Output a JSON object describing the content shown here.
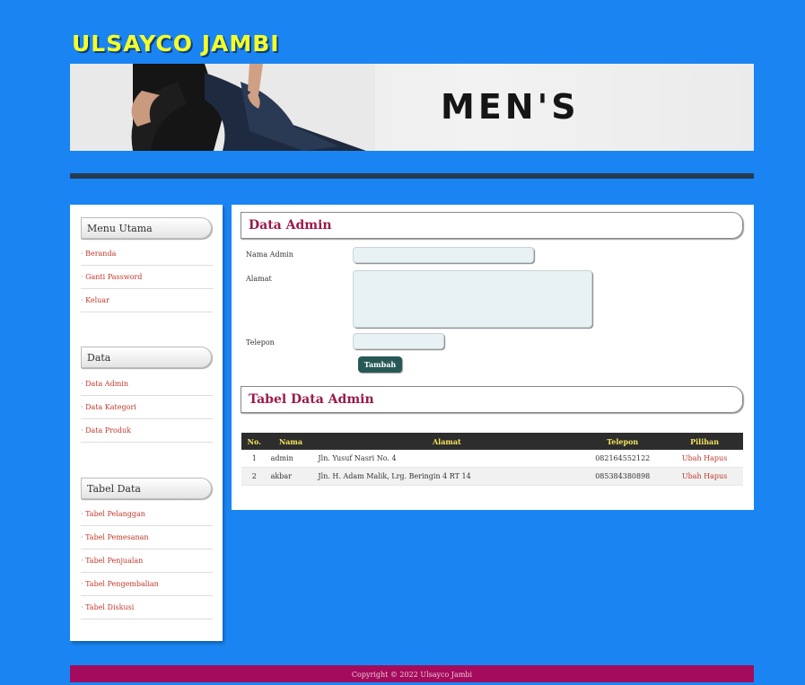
{
  "header": {
    "site_title": "ULSAYCO JAMBI",
    "banner_text": "MEN'S"
  },
  "sidebar": {
    "sections": [
      {
        "title": "Menu Utama",
        "items": [
          "Beranda",
          "Ganti Password",
          "Keluar"
        ]
      },
      {
        "title": "Data",
        "items": [
          "Data Admin",
          "Data Kategori",
          "Data Produk"
        ]
      },
      {
        "title": "Tabel Data",
        "items": [
          "Tabel Pelanggan",
          "Tabel Pemesanan",
          "Tabel Penjualan",
          "Tabel Pengembalian",
          "Tabel Diskusi"
        ]
      }
    ]
  },
  "form": {
    "heading": "Data Admin",
    "labels": {
      "nama": "Nama Admin",
      "alamat": "Alamat",
      "telepon": "Telepon"
    },
    "values": {
      "nama": "",
      "alamat": "",
      "telepon": ""
    },
    "submit_label": "Tambah"
  },
  "table": {
    "heading": "Tabel Data Admin",
    "columns": [
      "No.",
      "Nama",
      "Alamat",
      "Telepon",
      "Pilihan"
    ],
    "rows": [
      {
        "no": "1",
        "nama": "admin",
        "alamat": "Jln. Yusuf Nasri No. 4",
        "telepon": "082164552122",
        "edit": "Ubah",
        "delete": "Hapus"
      },
      {
        "no": "2",
        "nama": "akbar",
        "alamat": "Jln. H. Adam Malik, Lrg. Beringin 4 RT 14",
        "telepon": "085384380898",
        "edit": "Ubah",
        "delete": "Hapus"
      }
    ]
  },
  "footer": {
    "copyright": "Copyright © 2022 Ulsayco Jambi"
  },
  "colors": {
    "page_bg": "#1a85f2",
    "title_yellow": "#f4ff2a",
    "heading_maroon": "#9a1a4a",
    "link_red": "#c0392b",
    "button_teal": "#275856",
    "footer_bg": "#a50b5c"
  }
}
